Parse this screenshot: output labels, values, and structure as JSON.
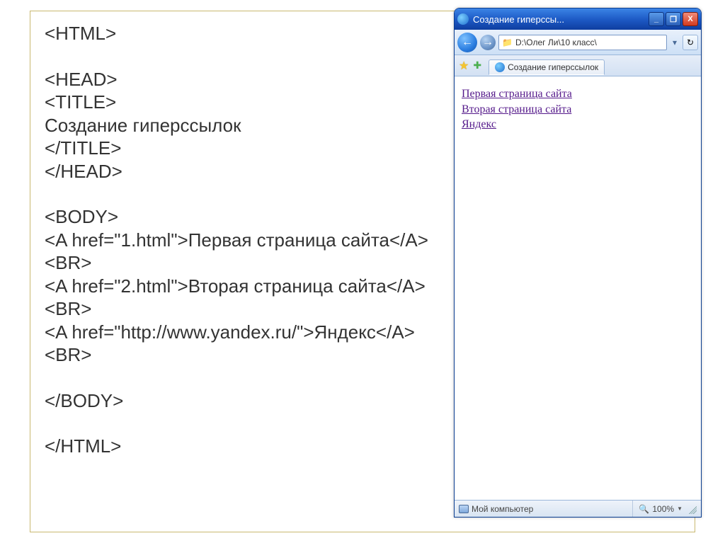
{
  "code": {
    "l1": "<HTML>",
    "l2": "<HEAD>",
    "l3": "<TITLE>",
    "l4": "Создание гиперссылок",
    "l5": "</TITLE>",
    "l6": "</HEAD>",
    "l7": "<BODY>",
    "l8": "<A href=\"1.html\">Первая страница сайта</A><BR>",
    "l9": "<A href=\"2.html\">Вторая страница сайта</A><BR>",
    "l10": "<A href=\"http://www.yandex.ru/\">Яндекс</A><BR>",
    "l11": "</BODY>",
    "l12": "</HTML>"
  },
  "ie": {
    "title": "Создание гиперссы...",
    "min": "_",
    "max": "❐",
    "close": "X",
    "back": "←",
    "fwd": "→",
    "address": "D:\\Олег Ли\\10 класс\\",
    "dropdown": "▾",
    "refresh": "↻",
    "tab": "Создание гиперссылок",
    "links": {
      "a": "Первая страница сайта",
      "b": "Вторая страница сайта",
      "c": "Яндекс"
    },
    "status_left": "Мой компьютер",
    "zoom": "100%"
  }
}
